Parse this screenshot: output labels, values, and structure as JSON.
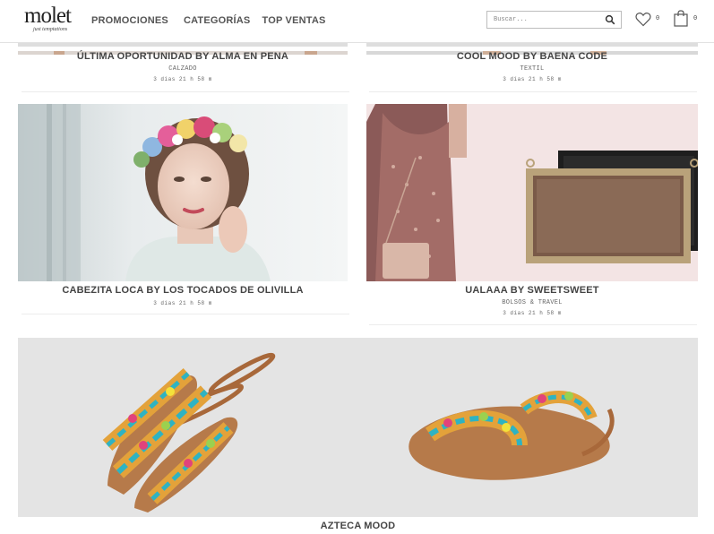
{
  "header": {
    "logo_text": "molet",
    "logo_tagline": "just temptations",
    "nav": [
      "PROMOCIONES",
      "CATEGORÍAS",
      "TOP VENTAS"
    ],
    "search_placeholder": "Buscar...",
    "wishlist_count": "0",
    "cart_count": "0",
    "icons": [
      "search-icon",
      "heart-icon",
      "shopping-bag-icon"
    ]
  },
  "campaigns": [
    {
      "title": "ÚLTIMA OPORTUNIDAD BY ALMA EN PENA",
      "category": "CALZADO",
      "time_left": "3 días 21 h 58 m"
    },
    {
      "title": "COOL MOOD BY BAENA CODE",
      "category": "TEXTIL",
      "time_left": "3 días 21 h 58 m"
    },
    {
      "title": "CABEZITA LOCA BY LOS TOCADOS DE OLIVILLA",
      "category": "",
      "time_left": "3 días 21 h 58 m"
    },
    {
      "title": "UALAAA BY SWEETSWEET",
      "category": "BOLSOS & TRAVEL",
      "time_left": "3 días 21 h 58 m"
    },
    {
      "title": "AZTECA MOOD",
      "category": "",
      "time_left": ""
    }
  ],
  "colors": {
    "text": "#444444",
    "divider": "#ececec",
    "photo_grey": "#e3e3e3",
    "pink_background": "#f5e6e6"
  }
}
